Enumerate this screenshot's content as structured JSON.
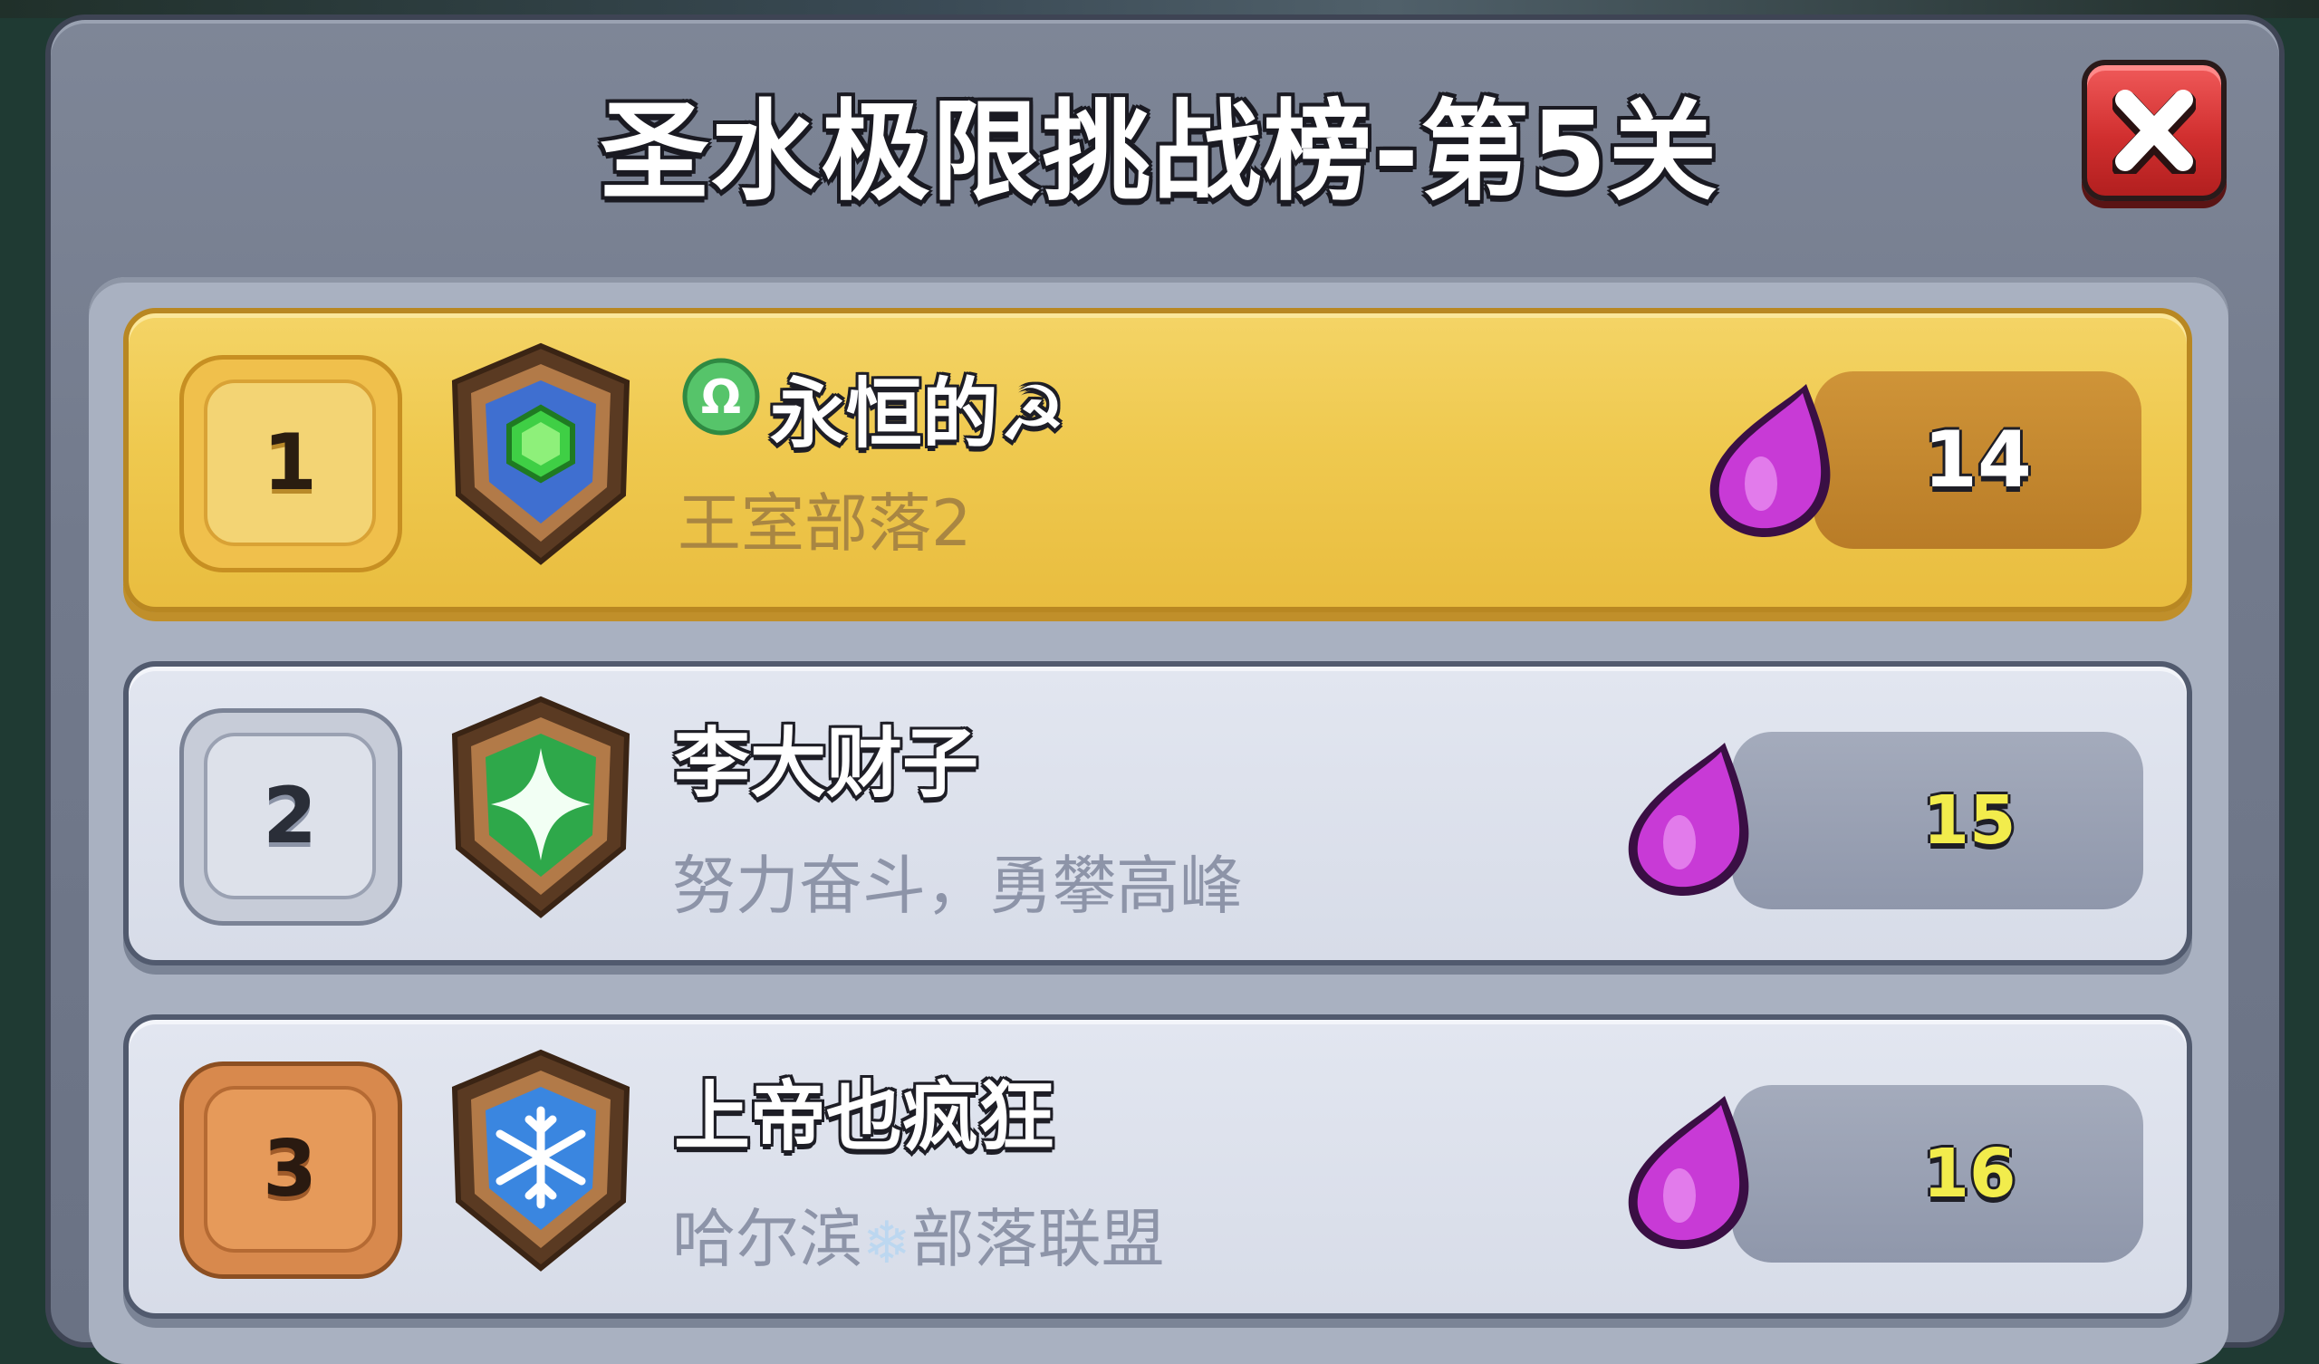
{
  "window": {
    "title": "圣水极限挑战榜-第5关"
  },
  "close_button": {
    "icon": "close-icon",
    "color": "#d63434"
  },
  "colors": {
    "first_row": "#efc94f",
    "other_rows": "#dde1ea",
    "elixir": "#c83ad6",
    "score_highlight": "#f2ec4c"
  },
  "leaderboard": [
    {
      "rank": "1",
      "name": "永恒的☭",
      "name_prefix_icon": "libra-icon",
      "clan": "王室部落2",
      "badge_icon": "green-gem-shield-icon",
      "score": "14"
    },
    {
      "rank": "2",
      "name": "李大财子",
      "clan": "努力奋斗，勇攀高峰",
      "badge_icon": "green-star-shield-icon",
      "score": "15"
    },
    {
      "rank": "3",
      "name": "上帝也疯狂",
      "clan_before": "哈尔滨",
      "clan_icon": "snowflake-icon",
      "clan_after": "部落联盟",
      "badge_icon": "snowflake-shield-icon",
      "score": "16"
    }
  ]
}
